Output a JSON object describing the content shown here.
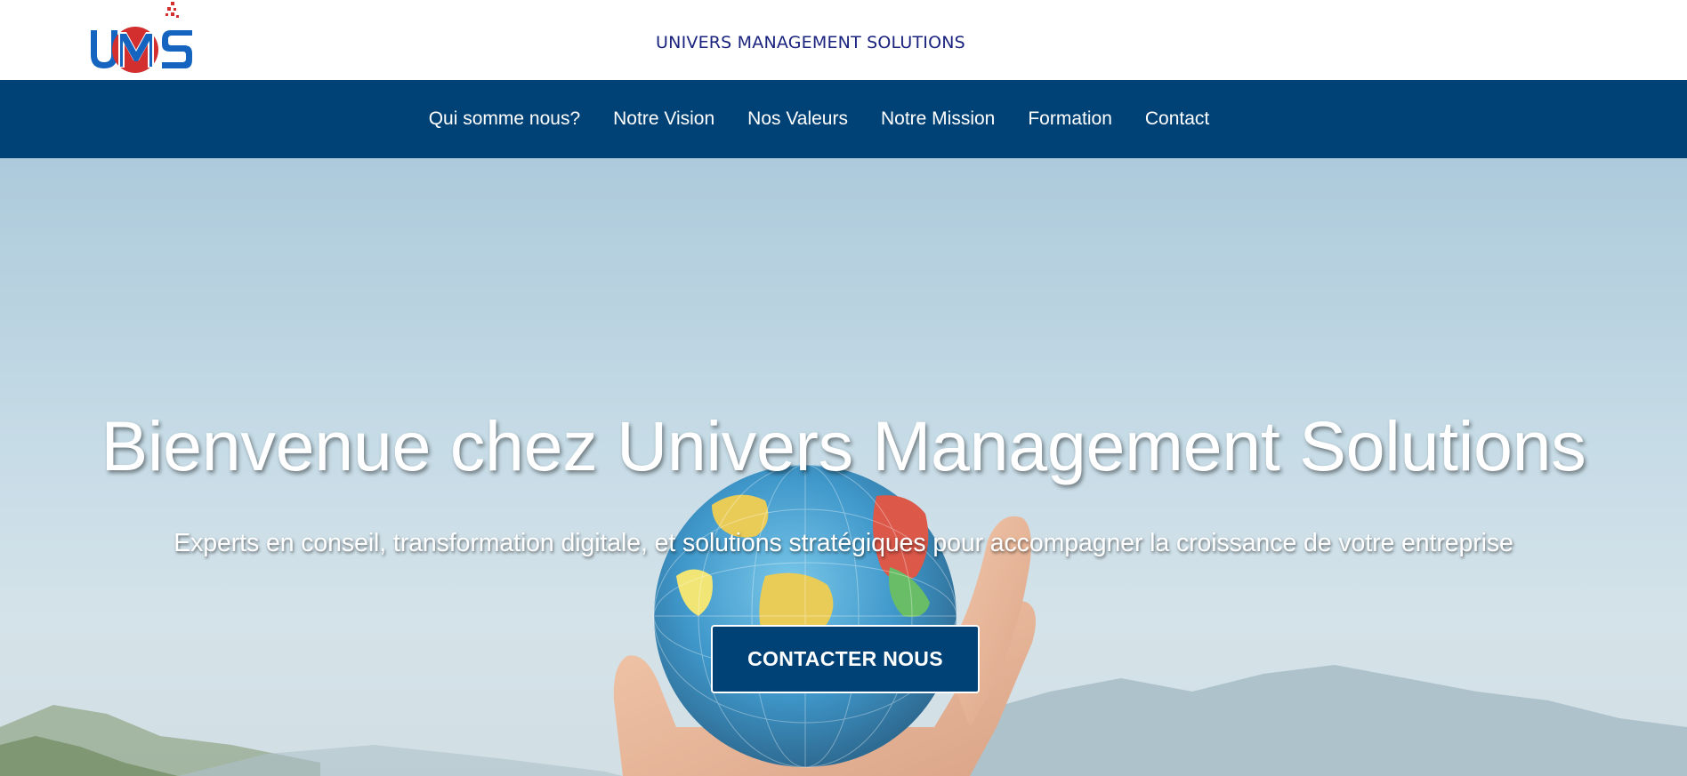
{
  "header": {
    "logo_text": "UMS",
    "site_title": "UNIVERS MANAGEMENT SOLUTIONS"
  },
  "nav": {
    "items": [
      {
        "label": "Qui somme nous?"
      },
      {
        "label": "Notre Vision"
      },
      {
        "label": "Nos Valeurs"
      },
      {
        "label": "Notre Mission"
      },
      {
        "label": "Formation"
      },
      {
        "label": "Contact"
      }
    ]
  },
  "hero": {
    "title": "Bienvenue chez Univers Management Solutions",
    "subtitle": "Experts en conseil, transformation digitale, et solutions stratégiques pour accompagner la croissance de votre entreprise",
    "cta_label": "CONTACTER NOUS",
    "background_image": "hand-holding-globe-photo"
  },
  "colors": {
    "nav_bg": "#004276",
    "title_text": "#1a237e",
    "logo_blue": "#1565c0",
    "logo_red": "#d32f2f",
    "cta_bg": "#004276"
  }
}
